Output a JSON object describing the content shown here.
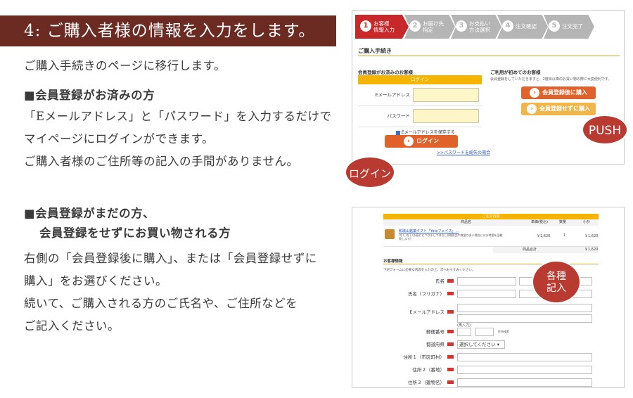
{
  "banner": {
    "title": "4: ご購入者様の情報を入力をします。"
  },
  "intro": "ご購入手続きのページに移行します。",
  "member_section": {
    "heading": "■会員登録がお済みの方",
    "lines": [
      "「Eメールアドレス」と「パスワード」を入力するだけで",
      "マイページにログインができます。",
      "ご購入者様のご住所等の記入の手間がありません。"
    ]
  },
  "guest_section": {
    "heading_1": "■会員登録がまだの方、",
    "heading_2": "会員登録をせずにお買い物される方",
    "lines": [
      "右側の「会員登録後に購入」、または「会員登録せずに",
      "購入」をお選びください。",
      "続いて、ご購入される方のご氏名や、ご住所などを",
      "ご記入ください。"
    ]
  },
  "screenshot1": {
    "steps": [
      {
        "num": "1",
        "label_1": "お客様",
        "label_2": "情報入力"
      },
      {
        "num": "2",
        "label_1": "お届け先",
        "label_2": "指定"
      },
      {
        "num": "3",
        "label_1": "お支払い",
        "label_2": "方法選択"
      },
      {
        "num": "4",
        "label_1": "注文確認",
        "label_2": ""
      },
      {
        "num": "5",
        "label_1": "注文完了",
        "label_2": ""
      }
    ],
    "procedure_title": "ご購入手続き",
    "member_title": "会員登録がお済みのお客様",
    "login_header": "ログイン",
    "email_label": "Eメールアドレス",
    "password_label": "パスワード",
    "remember_label": "Eメールアドレスを保存する",
    "login_button": "ログイン",
    "forgot_link": ">>パスワードを紛失の場合",
    "first_time_title": "ご利用が初めてのお客様",
    "first_time_note": "会員登録をしていただきますと、2度目以降のお買い物の際に大変便利です。",
    "register_buy_button": "会員登録後に購入",
    "guest_buy_button": "会員登録せずに購入"
  },
  "push_badge": "PUSH",
  "login_badge": "ログイン",
  "screenshot2": {
    "order_header": "ご注文内容",
    "columns": [
      "商品名",
      "単価(税込)",
      "数量",
      "小計"
    ],
    "product_name": "和歌山銘菓ギフト「Yotoフェイス」…",
    "product_note": "(なし)なし(お届けにつきましてはなし)(贈答品や数量が多い場合にはお時間を頂戴致します)",
    "unit_price": "￥1,620",
    "quantity": "1",
    "subtotal": "￥1,620",
    "total_label": "商品合計",
    "total_value": "￥1,620",
    "customer_title": "お客様情報",
    "customer_note": "下記フォームに必要な内容を入力の上、次へおすすみください。",
    "fields": {
      "name": "氏名",
      "furigana": "氏名（フリガナ）",
      "email": "Eメールアドレス",
      "email_confirm": "(再入力)",
      "postal": "郵便番号",
      "postal_hint": "住所検索",
      "prefecture": "都道府県",
      "prefecture_select": "選択してください",
      "address1": "住所１（市区町村）",
      "address2": "住所２（番地）",
      "address3": "住所３（建物名）"
    }
  },
  "kakushu_badge": {
    "line1": "各種",
    "line2": "記入"
  },
  "colors": {
    "banner": "#6b2a22",
    "badge": "#b93a30",
    "step_active": "#c8282a",
    "accent_gold": "#f5b400"
  }
}
